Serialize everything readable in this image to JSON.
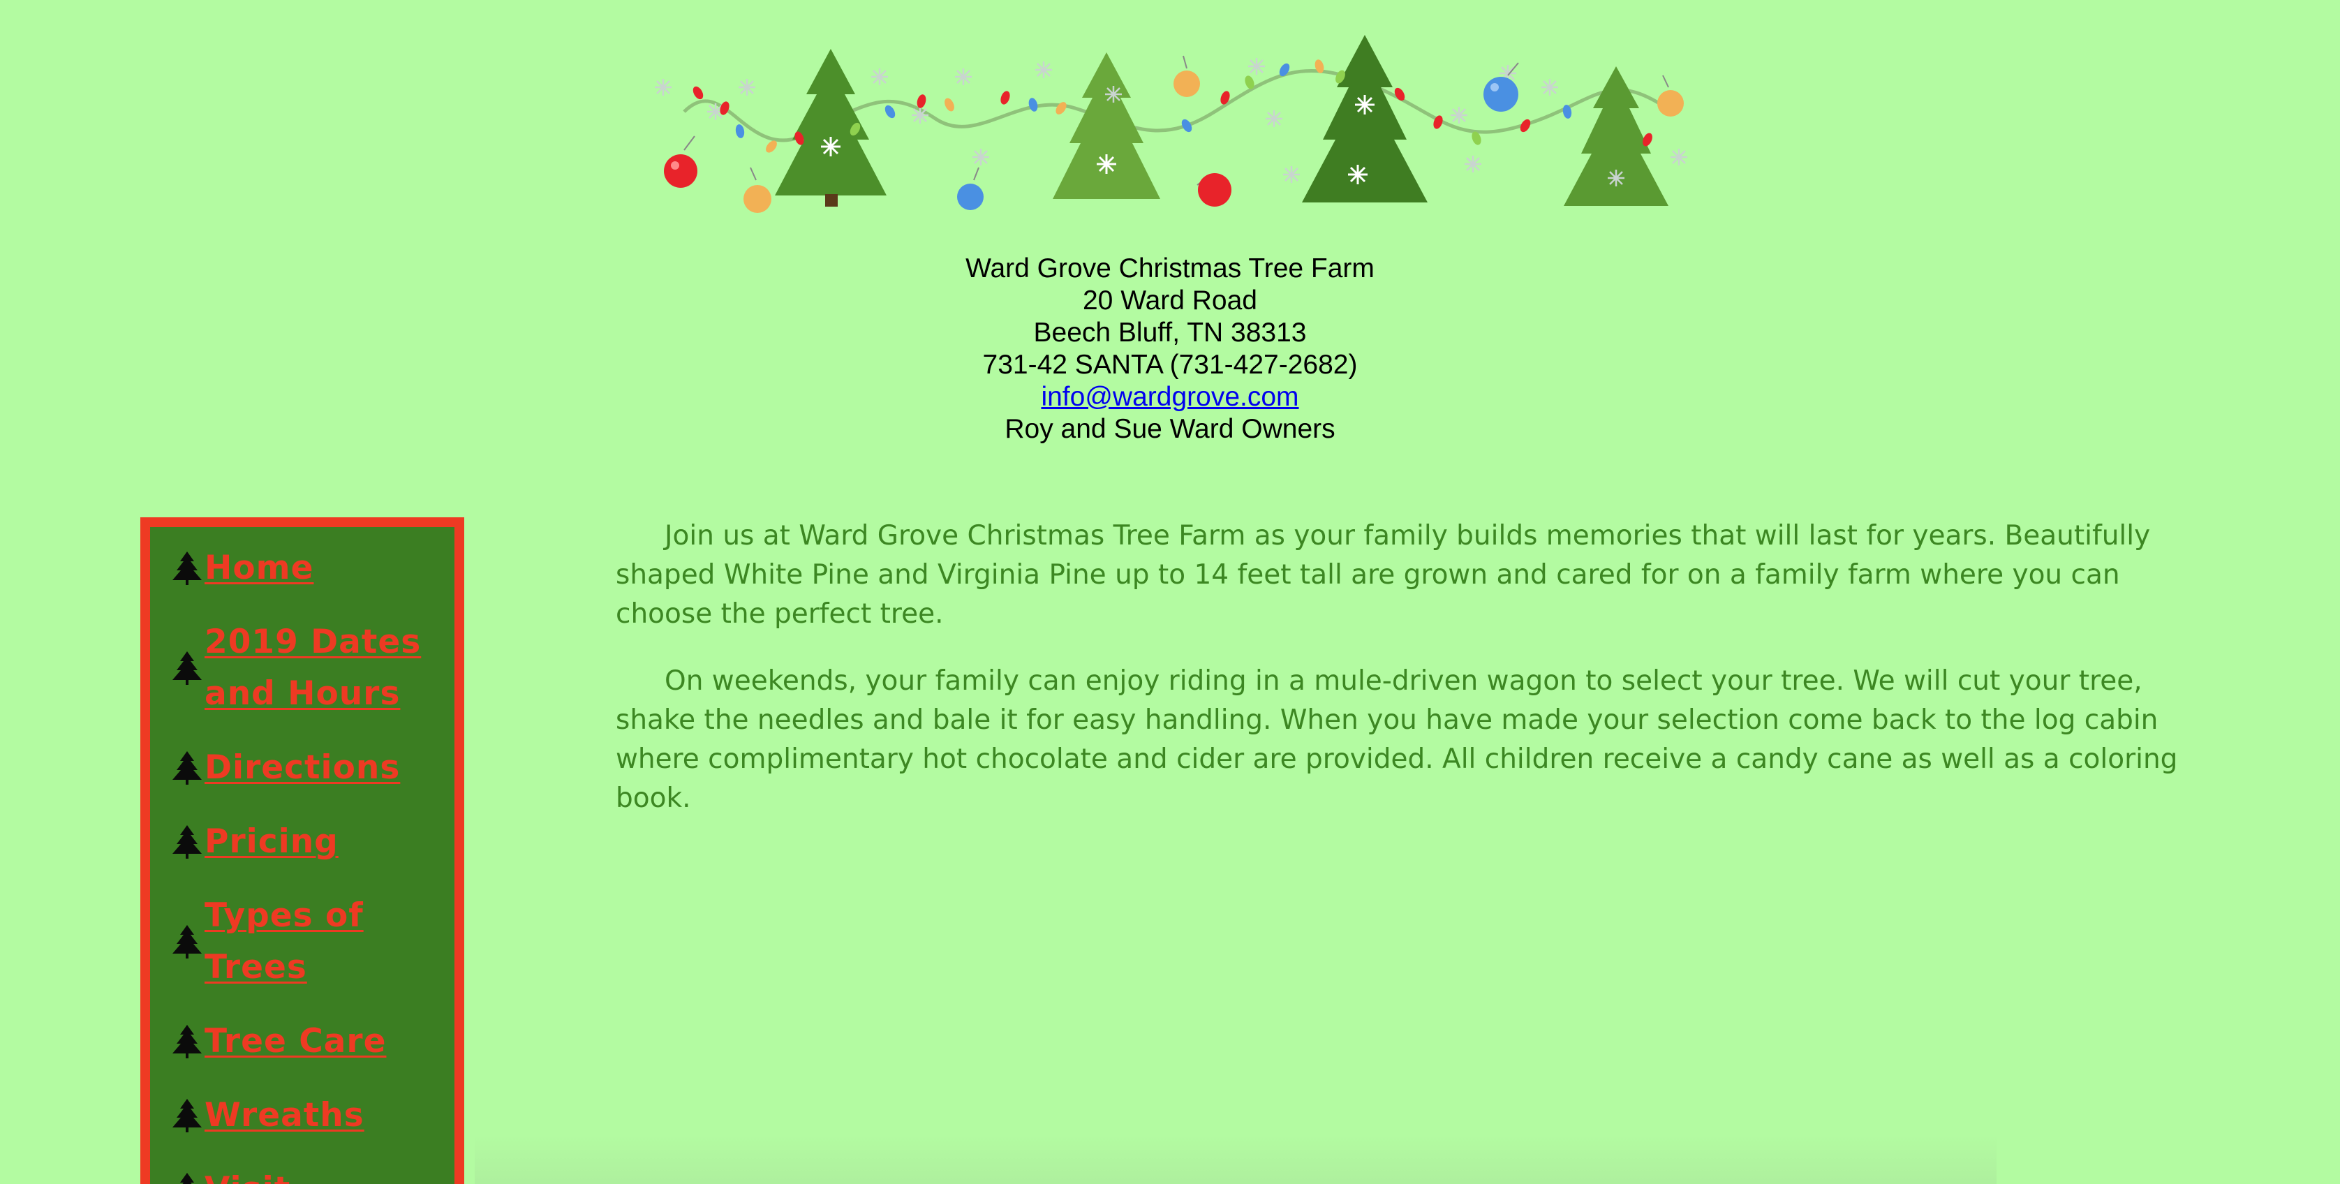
{
  "header": {
    "farm_name": "Ward Grove Christmas Tree Farm",
    "street": "20 Ward Road",
    "city_state_zip": "Beech Bluff, TN 38313",
    "phone": "731-42 SANTA (731-427-2682)",
    "email": "info@wardgrove.com",
    "owners": "Roy and Sue Ward Owners"
  },
  "sidebar": {
    "items": [
      {
        "label": "Home"
      },
      {
        "label": "2019 Dates and Hours"
      },
      {
        "label": "Directions"
      },
      {
        "label": "Pricing"
      },
      {
        "label": "Types of Trees"
      },
      {
        "label": "Tree Care"
      },
      {
        "label": "Wreaths"
      },
      {
        "label": "Visit"
      }
    ]
  },
  "content": {
    "paragraph_1": "Join us at Ward Grove Christmas Tree Farm as your family builds memories that will last for years. Beautifully shaped White Pine and Virginia Pine up to 14 feet tall are grown and cared for on a family farm where you can choose the perfect tree.",
    "paragraph_2": "On weekends, your family can enjoy riding in a mule-driven wagon to select your tree. We will cut your tree, shake the needles and bale it for easy handling. When you have made your selection come back to the log cabin where complimentary hot chocolate and cider are provided. All children receive a candy cane as well as a coloring book."
  },
  "colors": {
    "page_background": "#b3fba1",
    "sidebar_background": "#3b7e22",
    "sidebar_border": "#ee3a23",
    "nav_link": "#ee3a23",
    "body_text": "#3c8722",
    "tree_green": "#5a9a32",
    "tree_dark": "#3f7d22",
    "ornament_red": "#e8232a",
    "ornament_blue": "#4a90e2",
    "ornament_gold": "#f2b155"
  },
  "icons": {
    "nav_bullet": "christmas-tree-icon",
    "banner": "christmas-trees-garland-banner"
  }
}
